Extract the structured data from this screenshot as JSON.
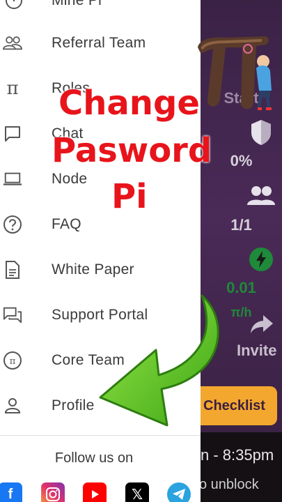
{
  "menu": [
    {
      "label": "Mine Pi",
      "icon": "mine-icon"
    },
    {
      "label": "Referral Team",
      "icon": "people-icon"
    },
    {
      "label": "Roles",
      "icon": "pi-icon"
    },
    {
      "label": "Chat",
      "icon": "chat-icon"
    },
    {
      "label": "Node",
      "icon": "laptop-icon"
    },
    {
      "label": "FAQ",
      "icon": "question-icon"
    },
    {
      "label": "White Paper",
      "icon": "document-icon"
    },
    {
      "label": "Support Portal",
      "icon": "support-chat-icon"
    },
    {
      "label": "Core Team",
      "icon": "core-team-icon"
    },
    {
      "label": "Profile",
      "icon": "person-icon"
    }
  ],
  "follow_label": "Follow us on",
  "social": [
    "facebook-icon",
    "instagram-icon",
    "youtube-icon",
    "x-icon",
    "telegram-icon"
  ],
  "overlay": {
    "line1": "Change",
    "line2": "Pasword",
    "line3": "Pi"
  },
  "background_app": {
    "stat_top": "Start",
    "percent": "0%",
    "team": "1/1",
    "rate": "0.01",
    "rate_unit": "π/h",
    "invite": "Invite",
    "checklist": "Checklist",
    "time": "n - 8:35pm",
    "unblock": "o unblock"
  },
  "colors": {
    "overlay_red": "#e8141b",
    "arrow_green": "#5ecb1d",
    "panel_purple": "#3e2547",
    "checklist_orange": "#f3a72e"
  }
}
